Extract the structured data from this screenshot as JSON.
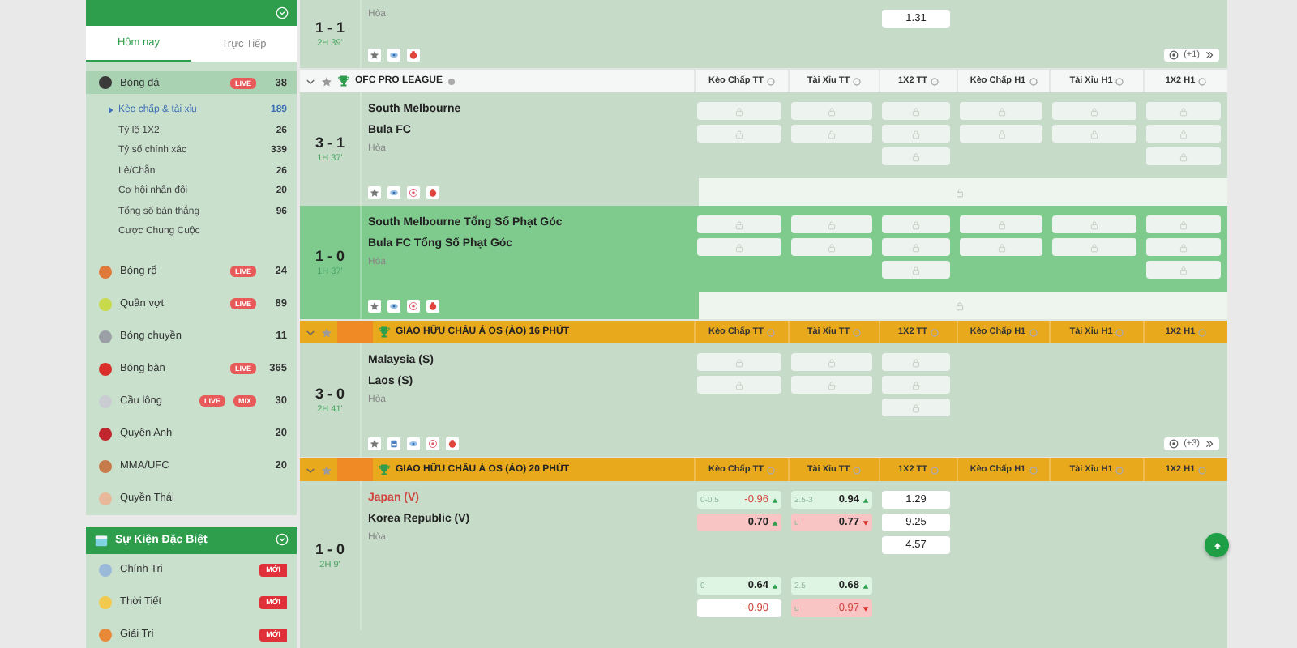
{
  "sidebar": {
    "tabs": [
      {
        "label": "Hôm nay",
        "selected": true
      },
      {
        "label": "Trực Tiếp",
        "selected": false
      }
    ],
    "sports": [
      {
        "name": "Bóng đá",
        "badges": [
          "LIVE"
        ],
        "count": "38",
        "selected": true,
        "color": "#3a3a3a",
        "children": [
          {
            "name": "Kèo chấp & tài xỉu",
            "count": "189",
            "selected": true
          },
          {
            "name": "Tỷ lệ 1X2",
            "count": "26",
            "selected": false
          },
          {
            "name": "Tỷ số chính xác",
            "count": "339",
            "selected": false
          },
          {
            "name": "Lẻ/Chẵn",
            "count": "26",
            "selected": false
          },
          {
            "name": "Cơ hội nhân đôi",
            "count": "20",
            "selected": false
          },
          {
            "name": "Tổng số bàn thắng",
            "count": "96",
            "selected": false
          },
          {
            "name": "Cược Chung Cuộc",
            "selected": false
          }
        ]
      },
      {
        "name": "Bóng rổ",
        "badges": [
          "LIVE"
        ],
        "count": "24",
        "selected": false,
        "color": "#e07a3a"
      },
      {
        "name": "Quần vợt",
        "badges": [
          "LIVE"
        ],
        "count": "89",
        "selected": false,
        "color": "#c8d94a"
      },
      {
        "name": "Bóng chuyền",
        "count": "11",
        "selected": false,
        "color": "#9aa0a6"
      },
      {
        "name": "Bóng bàn",
        "badges": [
          "LIVE"
        ],
        "count": "365",
        "selected": false,
        "color": "#d9302c"
      },
      {
        "name": "Cầu lông",
        "badges": [
          "LIVE",
          "MIX"
        ],
        "count": "30",
        "selected": false,
        "color": "#c9cdd2"
      },
      {
        "name": "Quyền Anh",
        "count": "20",
        "selected": false,
        "color": "#c0262d"
      },
      {
        "name": "MMA/UFC",
        "count": "20",
        "selected": false,
        "color": "#c77a4a"
      },
      {
        "name": "Quyền Thái",
        "selected": false,
        "color": "#e8b89a"
      }
    ],
    "special": {
      "title": "Sự Kiện Đặc Biệt",
      "items": [
        {
          "name": "Chính Trị",
          "badge": "MỚI",
          "color": "#9ab8d8"
        },
        {
          "name": "Thời Tiết",
          "badge": "MỚI",
          "color": "#f2c94c"
        },
        {
          "name": "Giải Trí",
          "badge": "MỚI",
          "color": "#e8893a"
        }
      ]
    }
  },
  "leagues": [
    {
      "more": "(+1)",
      "matches": [
        {
          "score": "1 - 1",
          "time": "2H 39'",
          "draw": "Hòa",
          "highlighted": false,
          "footer_locked": false,
          "tv": false,
          "target": false,
          "lines": [
            {
              "x12_tt": [
                {
                  "kind": "price",
                  "price": "1.31"
                }
              ]
            }
          ]
        }
      ]
    },
    {
      "kind": "plain",
      "name": "OFC PRO LEAGUE",
      "columns": [
        "Kèo Chấp TT",
        "Tài Xỉu TT",
        "1X2 TT",
        "Kèo Chấp H1",
        "Tài Xỉu H1",
        "1X2 H1"
      ],
      "matches": [
        {
          "score": "3 - 1",
          "time": "1H 37'",
          "teams": [
            {
              "name": "South Melbourne",
              "favored": false
            },
            {
              "name": "Bula FC",
              "favored": false
            }
          ],
          "draw": "Hòa",
          "highlighted": false,
          "footer_locked": true,
          "tv": false,
          "target": true,
          "lines": [
            {
              "kc_tt": [
                {
                  "kind": "locked"
                },
                {
                  "kind": "locked"
                }
              ],
              "tx_tt": [
                {
                  "kind": "locked"
                },
                {
                  "kind": "locked"
                }
              ],
              "x12_tt": [
                {
                  "kind": "locked"
                },
                {
                  "kind": "locked"
                },
                {
                  "kind": "locked"
                }
              ],
              "kc_h1": [
                {
                  "kind": "locked"
                },
                {
                  "kind": "locked"
                }
              ],
              "tx_h1": [
                {
                  "kind": "locked"
                },
                {
                  "kind": "locked"
                }
              ],
              "x12_h1": [
                {
                  "kind": "locked"
                },
                {
                  "kind": "locked"
                },
                {
                  "kind": "locked"
                }
              ]
            }
          ]
        },
        {
          "score": "1 - 0",
          "time": "1H 37'",
          "teams": [
            {
              "name": "South Melbourne Tổng Số Phạt Góc",
              "favored": false
            },
            {
              "name": "Bula FC Tổng Số Phạt Góc",
              "favored": false
            }
          ],
          "draw": "Hòa",
          "highlighted": true,
          "footer_locked": true,
          "tv": false,
          "target": true,
          "lines": [
            {
              "kc_tt": [
                {
                  "kind": "locked"
                },
                {
                  "kind": "locked"
                }
              ],
              "tx_tt": [
                {
                  "kind": "locked"
                },
                {
                  "kind": "locked"
                }
              ],
              "x12_tt": [
                {
                  "kind": "locked"
                },
                {
                  "kind": "locked"
                },
                {
                  "kind": "locked"
                }
              ],
              "kc_h1": [
                {
                  "kind": "locked"
                },
                {
                  "kind": "locked"
                }
              ],
              "tx_h1": [
                {
                  "kind": "locked"
                },
                {
                  "kind": "locked"
                }
              ],
              "x12_h1": [
                {
                  "kind": "locked"
                },
                {
                  "kind": "locked"
                },
                {
                  "kind": "locked"
                }
              ]
            }
          ]
        }
      ]
    },
    {
      "kind": "featured",
      "name": "GIAO HỮU CHÂU Á OS (ẢO) 16 PHÚT",
      "columns": [
        "Kèo Chấp TT",
        "Tài Xỉu TT",
        "1X2 TT",
        "Kèo Chấp H1",
        "Tài Xỉu H1",
        "1X2 H1"
      ],
      "more": "(+3)",
      "matches": [
        {
          "score": "3 - 0",
          "time": "2H 41'",
          "teams": [
            {
              "name": "Malaysia (S)",
              "favored": false
            },
            {
              "name": "Laos (S)",
              "favored": false
            }
          ],
          "draw": "Hòa",
          "highlighted": false,
          "footer_locked": false,
          "tv": true,
          "target": true,
          "lines": [
            {
              "kc_tt": [
                {
                  "kind": "locked"
                },
                {
                  "kind": "locked"
                }
              ],
              "tx_tt": [
                {
                  "kind": "locked"
                },
                {
                  "kind": "locked"
                }
              ],
              "x12_tt": [
                {
                  "kind": "locked"
                },
                {
                  "kind": "locked"
                },
                {
                  "kind": "locked"
                }
              ]
            }
          ]
        }
      ]
    },
    {
      "kind": "featured",
      "name": "GIAO HỮU CHÂU Á OS (ẢO) 20 PHÚT",
      "columns": [
        "Kèo Chấp TT",
        "Tài Xỉu TT",
        "1X2 TT",
        "Kèo Chấp H1",
        "Tài Xỉu H1",
        "1X2 H1"
      ],
      "matches": [
        {
          "score": "1 - 0",
          "time": "2H 9'",
          "teams": [
            {
              "name": "Japan (V)",
              "favored": true
            },
            {
              "name": "Korea Republic (V)",
              "favored": false
            }
          ],
          "draw": "Hòa",
          "highlighted": false,
          "lines": [
            {
              "kc_tt": [
                {
                  "kind": "odds",
                  "line": "0-0.5",
                  "price": "-0.96",
                  "negative": true,
                  "rising": true,
                  "color": "#dff5e3"
                },
                {
                  "kind": "odds",
                  "price": "0.70",
                  "negative": false,
                  "rising": true,
                  "color": "#f8c4c4"
                }
              ],
              "tx_tt": [
                {
                  "kind": "odds",
                  "line": "2.5-3",
                  "price": "0.94",
                  "negative": false,
                  "rising": true,
                  "color": "#dff5e3"
                },
                {
                  "kind": "odds",
                  "line": "u",
                  "price": "0.77",
                  "negative": false,
                  "rising": false,
                  "color": "#f8c4c4"
                }
              ],
              "x12_tt": [
                {
                  "kind": "price",
                  "price": "1.29"
                },
                {
                  "kind": "price",
                  "price": "9.25"
                },
                {
                  "kind": "price",
                  "price": "4.57"
                }
              ]
            },
            {
              "kc_tt": [
                {
                  "kind": "odds",
                  "line": "0",
                  "price": "0.64",
                  "negative": false,
                  "rising": true,
                  "color": "#dff5e3"
                },
                {
                  "kind": "odds",
                  "price": "-0.90",
                  "negative": true,
                  "color": "#ffffff"
                }
              ],
              "tx_tt": [
                {
                  "kind": "odds",
                  "line": "2.5",
                  "price": "0.68",
                  "negative": false,
                  "rising": true,
                  "color": "#dff5e3"
                },
                {
                  "kind": "odds",
                  "line": "u",
                  "price": "-0.97",
                  "negative": true,
                  "rising": false,
                  "color": "#f8c4c4"
                }
              ]
            }
          ]
        }
      ]
    }
  ]
}
